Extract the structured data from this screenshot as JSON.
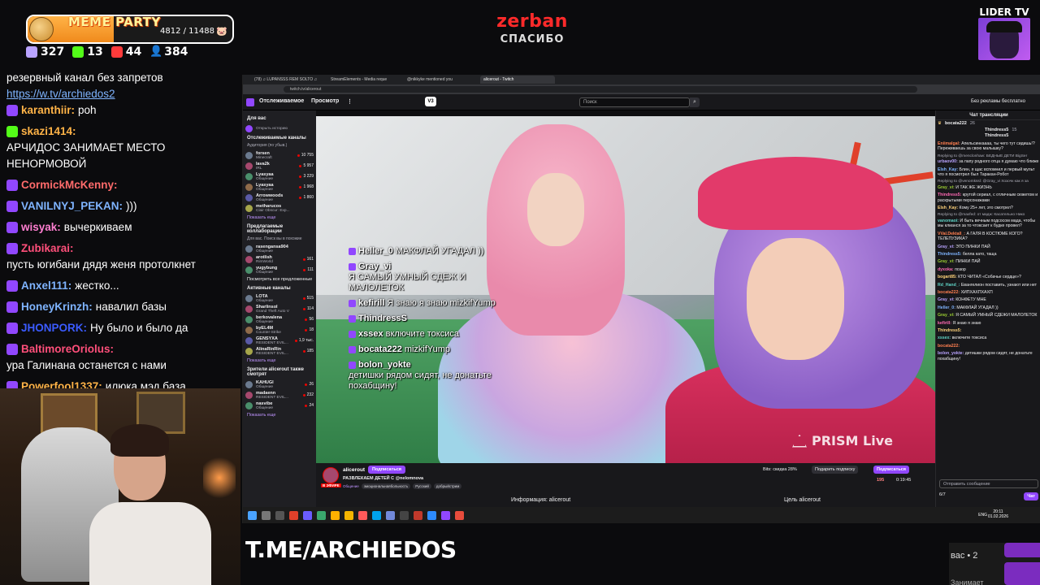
{
  "top_overlay": {
    "meme_party": {
      "title": "MEME PARTY",
      "count": "4812 / 11488",
      "progress": 0.42
    },
    "stats": [
      {
        "icon": "twitch-icon",
        "value": "327",
        "color": "#b9a3ff"
      },
      {
        "icon": "kick-icon",
        "value": "13",
        "color": "#53fc18"
      },
      {
        "icon": "vk-icon",
        "value": "44",
        "color": "#ff3b3b"
      },
      {
        "icon": "viewers-icon",
        "value": "384",
        "color": "#7fb4ff"
      }
    ],
    "sponsor": {
      "name": "zerban",
      "subtitle": "СПАСИБО"
    },
    "lider": {
      "label": "LIDER TV"
    }
  },
  "overlay_chat": {
    "first_line": "резервный канал без запретов",
    "link": "https://w.tv/archiedos2",
    "messages": [
      {
        "user": "karanthiir:",
        "color": "#ffb347",
        "text": "poh",
        "badge": "#9147ff"
      },
      {
        "user": "skazi1414:",
        "color": "#ffb347",
        "text": "АРЧИДОС ЗАНИМАЕТ МЕСТО НЕНОРМОВОЙ",
        "badge": "#53fc18"
      },
      {
        "user": "CormickMcKenny:",
        "color": "#ff6b6b",
        "text": "",
        "badge": "#9147ff"
      },
      {
        "user": "VANILNYJ_PEKAN:",
        "color": "#7fb4ff",
        "text": ")))",
        "badge": "#9147ff"
      },
      {
        "user": "wisyak:",
        "color": "#ff7fd1",
        "text": "вычеркиваем",
        "badge": "#9147ff"
      },
      {
        "user": "Zubikarai:",
        "color": "#ff4f7a",
        "text": "пусть югибани дядя женя протолкнет",
        "badge": "#9147ff"
      },
      {
        "user": "Anxel111:",
        "color": "#7fb4ff",
        "text": "жестко...",
        "badge": "#9147ff"
      },
      {
        "user": "HoneyKrinzh:",
        "color": "#7fb4ff",
        "text": "навалил базы",
        "badge": "#9147ff"
      },
      {
        "user": "JHONPORK:",
        "color": "#3b5bff",
        "text": "Ну было и было да",
        "badge": "#9147ff"
      },
      {
        "user": "BaltimoreOriolus:",
        "color": "#ff4f7a",
        "text": "ура Галинана останется с нами",
        "badge": "#9147ff"
      },
      {
        "user": "Powerfool1337:",
        "color": "#ffb347",
        "text": "илюка мэд база",
        "badge": "#9147ff"
      }
    ]
  },
  "browser": {
    "tabs": [
      {
        "label": "(78) ♫ LUPANSSS REM SOLTO ♫",
        "active": false
      },
      {
        "label": "StreamElements - Media reque",
        "active": false
      },
      {
        "label": "@nikkyke mentioned you",
        "active": false
      },
      {
        "label": "alicerout - Twitch",
        "active": true
      }
    ],
    "url": "twitch.tv/alicerout",
    "twitch_nav": {
      "following": "Отслеживаемое",
      "browse": "Просмотр",
      "badge": "V3",
      "search_placeholder": "Поиск",
      "no_ads": "Без рекламы бесплатно"
    },
    "sidebar": {
      "for_you": "Для вас",
      "history": "Открыть историю",
      "followed_head": "Отслеживаемые каналы",
      "followed_sub": "Аудитория (по убыв.)",
      "followed": [
        {
          "name": "forsen",
          "game": "Minecraft",
          "count": "10 755"
        },
        {
          "name": "lava2k",
          "game": "IRL",
          "count": "5 957"
        },
        {
          "name": "Lyasyaa",
          "game": "Общение",
          "count": "3 229"
        },
        {
          "name": "Lyasyaa",
          "game": "Общение",
          "count": "1 968"
        },
        {
          "name": "Arrowwoods",
          "game": "Общение",
          "count": "1 860"
        },
        {
          "name": "metharucos",
          "game": "Clair Obscur: Exp...",
          "count": ""
        }
      ],
      "show_more": "Показать еще",
      "collab_head": "Предлагаемые коллаборации",
      "collab_sub": "Для вас. Поиск вы в похожие",
      "collab": [
        {
          "name": "rasengansa904",
          "game": "Общение",
          "count": ""
        },
        {
          "name": "arotlish",
          "game": "RimWorld",
          "count": "161"
        },
        {
          "name": "yugybung",
          "game": "Общение",
          "count": "111"
        }
      ],
      "see_all": "Посмотреть все предложенные",
      "active_head": "Активные каналы",
      "active": [
        {
          "name": "LOTA",
          "game": "Общение",
          "count": "515"
        },
        {
          "name": "Sharlinsol",
          "game": "Grand Theft Auto V",
          "count": "114"
        },
        {
          "name": "berkovalena",
          "game": "Общение",
          "count": "56"
        },
        {
          "name": "byEL4M",
          "game": "Counter-Strike",
          "count": "18"
        },
        {
          "name": "GENSYXA",
          "game": "RESIDENT EVIL...",
          "count": "1,9 тыс."
        },
        {
          "name": "AlinaRinRin",
          "game": "RESIDENT EVIL...",
          "count": "185"
        }
      ],
      "show_more2": "Показать еще",
      "also_head": "Зрители alicerout также смотрят",
      "also": [
        {
          "name": "KAHUGI",
          "game": "Общение",
          "count": "26"
        },
        {
          "name": "madaenn",
          "game": "RESIDENT EVIL...",
          "count": "232"
        },
        {
          "name": "nasvibe",
          "game": "Общение",
          "count": "24"
        }
      ],
      "show_more3": "Показать еще"
    },
    "video_chat": [
      {
        "user": "Heller_0",
        "text": "МАКФЛАЙ УГАДАЛ ))"
      },
      {
        "user": "Gray_vi",
        "text": "Я САМЫЙ УМНЫЙ СДЕЖ И МАЛОЛЕТОК"
      },
      {
        "user": "kefirill",
        "text": "Я знаю я знаю mizkifYump"
      },
      {
        "user": "ThindressS",
        "text": ""
      },
      {
        "user": "xssex",
        "text": "включите токсиса"
      },
      {
        "user": "bocata222",
        "text": "mizkifYump"
      },
      {
        "user": "bolon_yokte",
        "text": "детишки рядом сидят, не донатьте похабщину!"
      }
    ],
    "prism": "PRISM Live",
    "channel": {
      "name": "alicerout",
      "follow": "Подписаться",
      "live": "В ЭФИРЕ",
      "title": "РАЗВЛЕКАЕМ ДЕТЕЙ С @nelomnova",
      "category": "Общение",
      "tags": [
        "эмоциональнаябольность",
        "Русский",
        "добрыйстрим"
      ],
      "bits": "Bits: скидка 28%",
      "gift": "Подарить подписку",
      "subscribe": "Подписаться",
      "viewers": "195",
      "uptime": "0:19:45",
      "about": "Информация: alicerout",
      "goal": "Цель alicerout"
    },
    "chat": {
      "header": "Чат трансляции",
      "top_users": [
        "bocata222",
        "Thindress5",
        "Thindress5"
      ],
      "top_counts": [
        "26",
        "15",
        ""
      ],
      "messages": [
        {
          "reply": "",
          "user": "Eniimalgal:",
          "text": "Апельсинкаааа, ты чего тут сидишь!? Переживаешь за свою малышку?"
        },
        {
          "reply": "Replying to @menclonhaw: БЕДНЫЕ ДЕТИ BigSer",
          "user": "urbaov00:",
          "text": "за папу родного отца я думаю что ближе"
        },
        {
          "reply": "",
          "user": "Elsh_Kay:",
          "text": "Блин, я щас вспомнил и первый мульт что я посмотрел был Таракан-Робот"
        },
        {
          "reply": "Replying to @venomkssl: @Gray_vi Хозочк как я за",
          "user": "Gray_vi:",
          "text": "И ТАК ЖЕ ЖИЗНЬ"
        },
        {
          "reply": "",
          "user": "Thindress5:",
          "text": "крутой сериал, с отличным сюжетом и раскрытыми персонажами"
        },
        {
          "reply": "",
          "user": "Elsh_Kay:",
          "text": "Кому 25+ лет, это смотрел?"
        },
        {
          "reply": "Replying to @maxfed: от мадж: Касательно Нико",
          "user": "vanomaoi:",
          "text": "И быть вечным подсосом мада, чтобы мы клианся за то чтоксает к будке провел?"
        },
        {
          "reply": "",
          "user": "VVal.Dektall_:",
          "text": "А ГАЛЯ В КОСТЮМЕ КОГО? ТЕЛЕПУЗИКА?"
        },
        {
          "reply": "",
          "user": "Gray_vi:",
          "text": "ЭТО ПИНКИ ПАЙ"
        },
        {
          "reply": "",
          "user": "Thindress5:",
          "text": "белла като, таща"
        },
        {
          "reply": "",
          "user": "Gray_vi:",
          "text": "ПИНКИ ПАЙ"
        },
        {
          "reply": "",
          "user": "dyxoka:",
          "text": "позор"
        },
        {
          "reply": "",
          "user": "bogart85:",
          "text": "КТО ЧИТАЛ «Собачье сердце»?"
        },
        {
          "reply": "",
          "user": "Rd_Hand_:",
          "text": "Евангелион поставить, узнают или нет"
        },
        {
          "reply": "",
          "user": "bocata222:",
          "text": "ХИПХАХПХАХП"
        },
        {
          "reply": "",
          "user": "Gray_vi:",
          "text": "КОНФЕТУ МНЕ"
        },
        {
          "reply": "",
          "user": "Heller_0:",
          "text": "МАКФЛАЙ УГАДАЛ ))"
        },
        {
          "reply": "",
          "user": "Gray_vi:",
          "text": "Я САМЫЙ УМНЫЙ СДЕЖИ МАЛОЛЕТОК"
        },
        {
          "reply": "",
          "user": "kefirill:",
          "text": "Я знаю я знаю"
        },
        {
          "reply": "",
          "user": "Thindress5:",
          "text": ""
        },
        {
          "reply": "",
          "user": "xssex:",
          "text": "включите токсиса"
        },
        {
          "reply": "",
          "user": "bocata222:",
          "text": ""
        },
        {
          "reply": "",
          "user": "bolon_yokte:",
          "text": "детишки рядом сидят, не донатьте похабщину!"
        }
      ],
      "input_placeholder": "Отправить сообщение",
      "points": "6/7",
      "send": "Чат"
    },
    "taskbar": {
      "time": "20:11",
      "date": "01.02.2026",
      "lang": "ENG"
    }
  },
  "bottom_overlay": {
    "text": "T.ME/ARCHIEDOS",
    "right_text": "вас • 2",
    "right_text2": "Занимает"
  }
}
